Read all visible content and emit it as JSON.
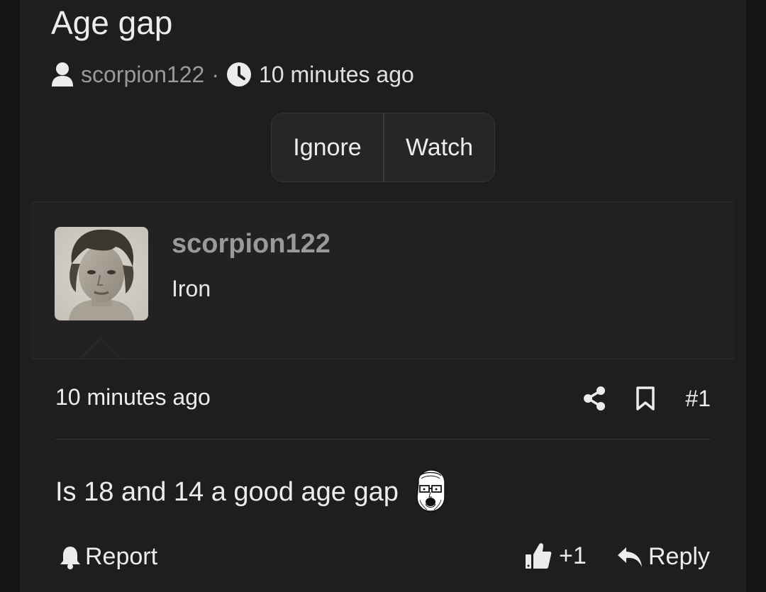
{
  "thread": {
    "title": "Age gap",
    "author": "scorpion122",
    "separator": "·",
    "time": "10 minutes ago",
    "buttons": {
      "ignore": "Ignore",
      "watch": "Watch"
    }
  },
  "post": {
    "username": "scorpion122",
    "user_title": "Iron",
    "time": "10 minutes ago",
    "number": "#1",
    "body": "Is 18 and 14 a good age gap",
    "emoji_icon": "soyjak-emoji-icon",
    "actions": {
      "report": "Report",
      "like_count": "+1",
      "reply": "Reply"
    }
  },
  "icons": {
    "author": "user-icon",
    "time": "clock-icon",
    "share": "share-icon",
    "bookmark": "bookmark-icon",
    "report": "bell-icon",
    "like": "thumbs-up-icon",
    "reply": "reply-arrow-icon"
  },
  "colors": {
    "background": "#1e1e1e",
    "page_edge": "#141414",
    "user_block": "#222222",
    "muted_text": "#9a9a9a",
    "text": "#ececec"
  }
}
